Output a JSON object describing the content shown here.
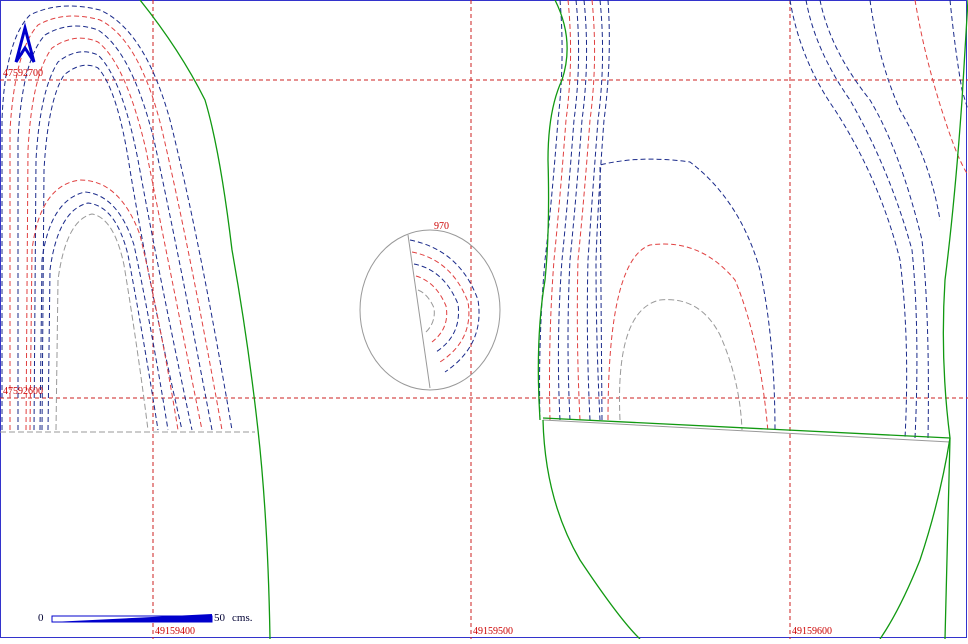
{
  "map": {
    "grid": {
      "easting_labels": [
        "49159400",
        "49159500",
        "49159600"
      ],
      "northing_labels": [
        "47592700",
        "47592600"
      ],
      "color": "#cc2222"
    },
    "contour_label": "970",
    "scale_bar": {
      "start_label": "0",
      "end_label": "50",
      "unit_label": "cms.",
      "color": "#0000cc"
    },
    "north_arrow_color": "#0000cc",
    "colors": {
      "contour_primary": "#1a2a8a",
      "contour_secondary": "#e04040",
      "contour_tertiary": "#999999",
      "boundary": "#119911"
    }
  }
}
